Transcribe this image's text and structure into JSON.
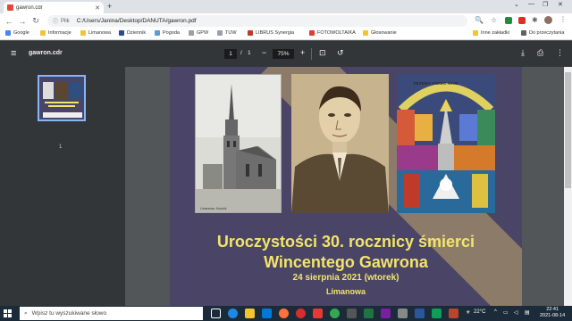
{
  "browser": {
    "tab_title": "gawron.cdr",
    "address_scheme": "Plik",
    "address_url": "C:/Users/Janina/Desktop/DANUTA/gawron.pdf",
    "bookmarks": [
      "Google",
      "Informacje",
      "Limanowa",
      "Dziennik",
      "Pogoda",
      "GPW",
      "TUW",
      "LIBRUS Synergia",
      "FOTOWOLTAIKA",
      "Głosowanie",
      "Inne zakładki",
      "Do przeczytania"
    ]
  },
  "pdf_viewer": {
    "file_title": "gawron.cdr",
    "current_page": "1",
    "page_separator": "/",
    "total_pages": "1",
    "zoom": "75%",
    "thumbnail_label": "1"
  },
  "document": {
    "title_line1": "Uroczystości 30. rocznicy śmierci",
    "title_line2": "Wincentego Gawrona",
    "date_line": "24 sierpnia 2021 (wtorek)",
    "place": "Limanowa",
    "postcard_caption": "Limanowa. Kościół.",
    "stained_glass_text": "TRZEBA SWIEC NAM",
    "colors": {
      "background": "#4a4466",
      "accent_stripe": "#8c7b68",
      "title_text": "#f2e56a"
    }
  },
  "taskbar": {
    "search_placeholder": "Wpisz tu wyszukiwane słowo",
    "temperature": "22°C",
    "time": "22:41",
    "date": "2021-08-14"
  }
}
